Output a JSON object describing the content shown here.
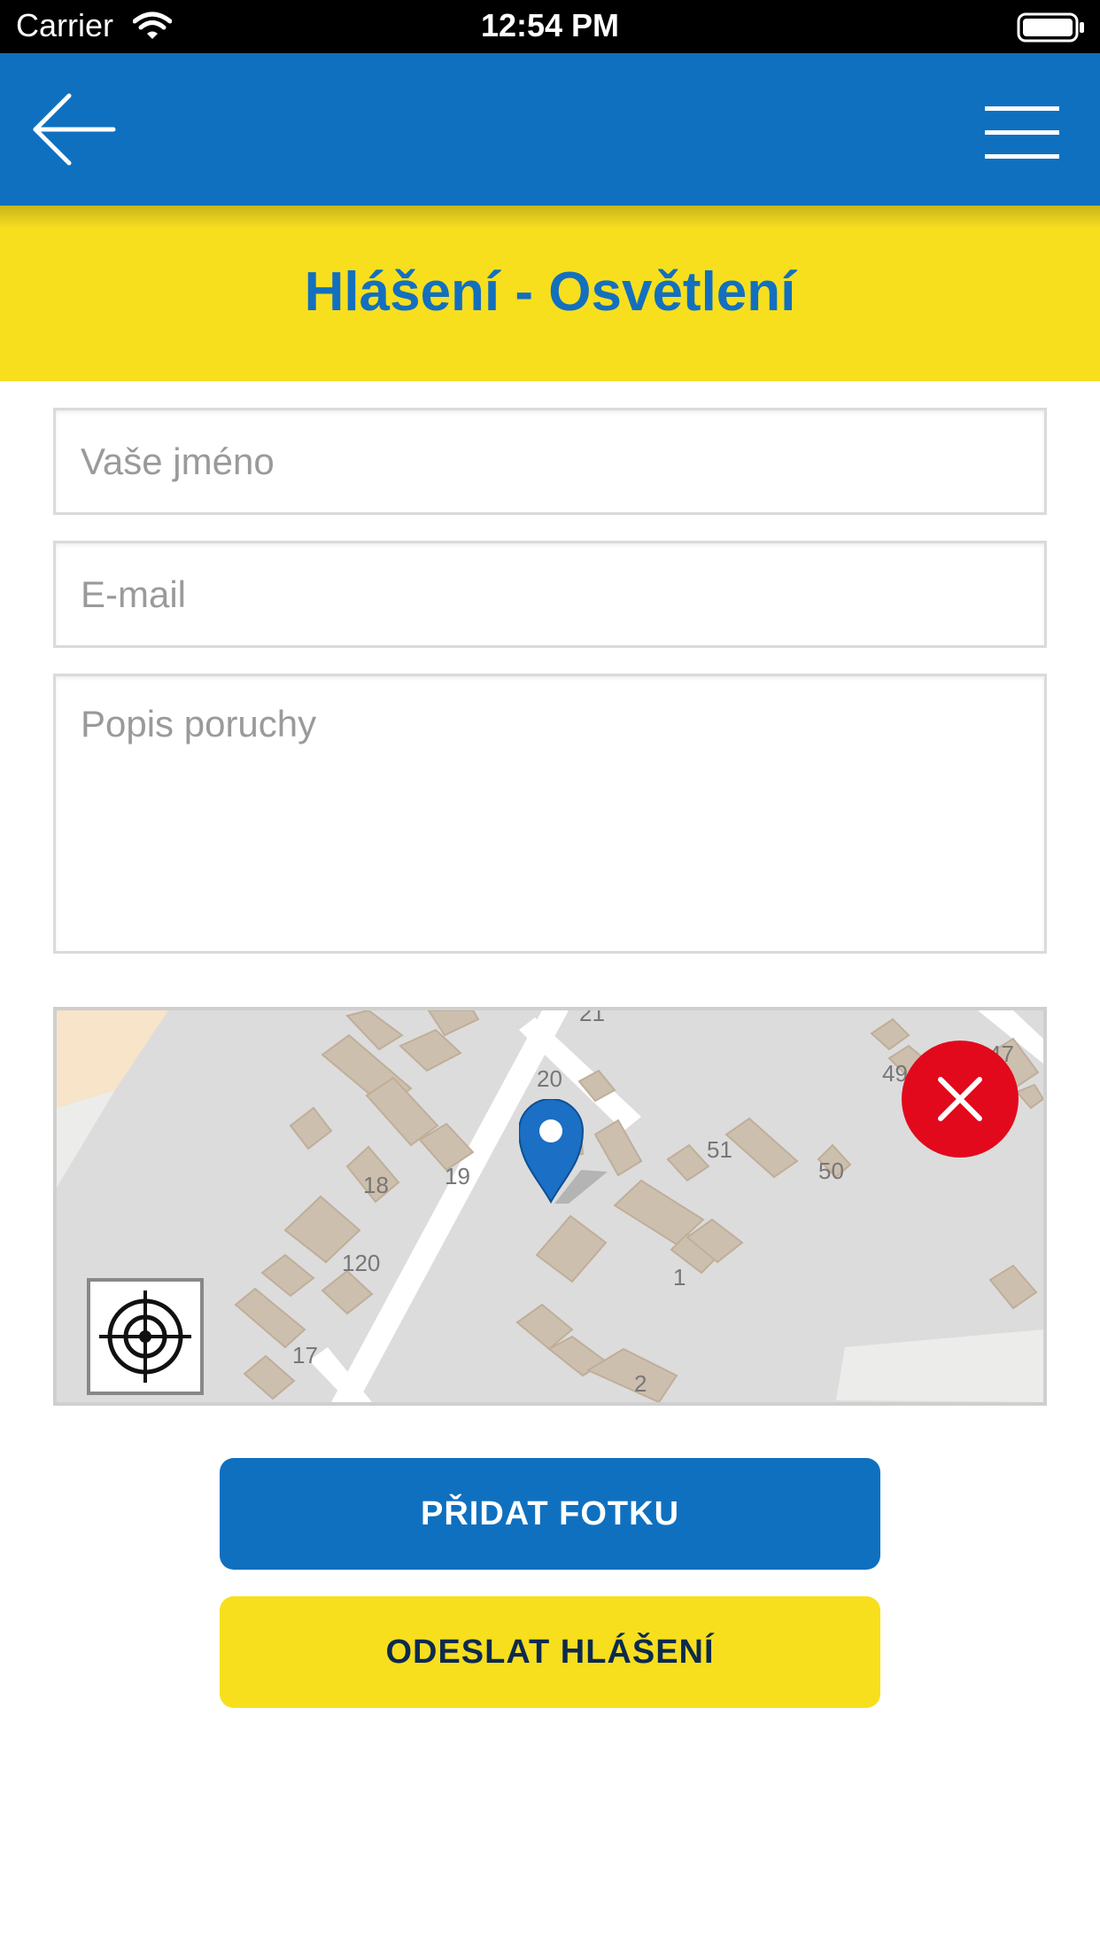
{
  "status_bar": {
    "carrier": "Carrier",
    "time": "12:54 PM"
  },
  "nav": {
    "back_icon": "arrow-left-icon",
    "menu_icon": "hamburger-menu-icon"
  },
  "title": "Hlášení - Osvětlení",
  "form": {
    "name_placeholder": "Vaše jméno",
    "email_placeholder": "E-mail",
    "description_placeholder": "Popis poruchy"
  },
  "map": {
    "house_numbers": [
      "21",
      "20",
      "49",
      "47",
      "51",
      "50",
      "18",
      "19",
      "120",
      "1",
      "17",
      "2"
    ],
    "pin_icon": "map-pin-icon",
    "close_icon": "close-icon",
    "locate_icon": "crosshair-icon"
  },
  "buttons": {
    "add_photo": "PŘIDAT FOTKU",
    "send_report": "ODESLAT HLÁŠENÍ"
  },
  "colors": {
    "primary_blue": "#0f70c0",
    "accent_yellow": "#f7df1e",
    "close_red": "#e2091c"
  }
}
